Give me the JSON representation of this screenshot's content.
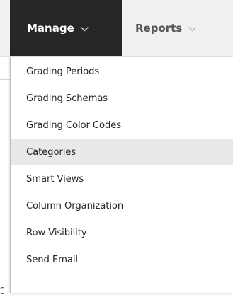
{
  "menubar": {
    "tabs": [
      {
        "label": "Manage",
        "active": true,
        "icon": "chevron-down-icon"
      },
      {
        "label": "Reports",
        "active": false,
        "icon": "chevron-down-icon"
      }
    ]
  },
  "dropdown": {
    "items": [
      {
        "label": "Grading Periods",
        "highlighted": false
      },
      {
        "label": "Grading Schemas",
        "highlighted": false
      },
      {
        "label": "Grading Color Codes",
        "highlighted": false
      },
      {
        "label": "Categories",
        "highlighted": true
      },
      {
        "label": "Smart Views",
        "highlighted": false
      },
      {
        "label": "Column Organization",
        "highlighted": false
      },
      {
        "label": "Row Visibility",
        "highlighted": false
      },
      {
        "label": "Send Email",
        "highlighted": false
      }
    ]
  },
  "colors": {
    "menubar_background": "#f1f1f1",
    "active_tab_background": "#262626",
    "active_tab_text": "#ffffff",
    "inactive_tab_text": "#555555",
    "highlight_background": "#e9e9e9",
    "item_text": "#262626"
  }
}
